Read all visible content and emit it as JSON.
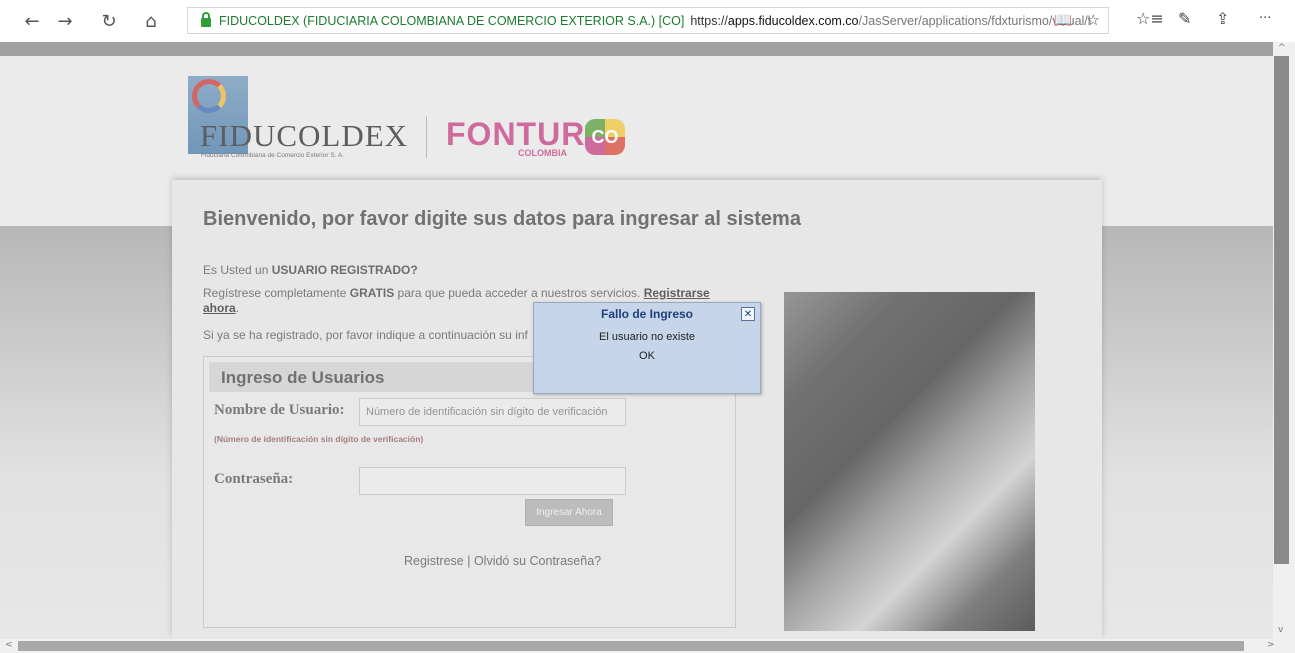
{
  "browser": {
    "address": {
      "site_identity": "FIDUCOLDEX (FIDUCIARIA COLOMBIANA DE COMERCIO EXTERIOR S.A.) [CO]",
      "url_scheme": "https://",
      "url_host": "apps.fiducoldex.com.co",
      "url_path": "/JasServer/applications/fdxturismo/visual/l"
    },
    "icons": {
      "back": "←",
      "forward": "→",
      "refresh": "↻",
      "home": "⌂",
      "reading_view": "📖",
      "favorite": "☆",
      "favorites_hub": "☆≡",
      "notes": "✎",
      "share": "⇪",
      "more": "···"
    }
  },
  "logos": {
    "fiducoldex_name": "FIDUCOLDEX",
    "fiducoldex_sub": "Fiduciaria Colombiana de Comercio Exterior S. A.",
    "fontur": "FONTUR",
    "fontur_sub": "COLOMBIA",
    "co_badge": "CO"
  },
  "main": {
    "welcome": "Bienvenido, por favor digite sus datos para ingresar al sistema",
    "registered_prefix": "Es Usted un ",
    "registered_bold": "USUARIO REGISTRADO?",
    "register_prefix": "Regístrese completamente ",
    "register_bold": "GRATIS",
    "register_middle": " para que pueda acceder a nuestros servicios. ",
    "register_link_1": "Registrarse",
    "register_link_2": "ahora",
    "register_dot": ".",
    "already_registered": "Si ya se ha registrado, por favor indique a continuación su inf"
  },
  "login": {
    "title": "Ingreso de Usuarios",
    "username_label": "Nombre de Usuario:",
    "username_placeholder": "Número de identificación sin dígito de verificación",
    "username_hint": "(Número de identificación sin dígito de verificación)",
    "password_label": "Contraseña:",
    "password_value": "",
    "submit_label": "Ingresar Ahora",
    "register_link": "Registrese",
    "separator": " | ",
    "forgot_link": "Olvidó su Contraseña?"
  },
  "dialog": {
    "title": "Fallo de Ingreso",
    "message": "El usuario no existe",
    "ok_label": "OK",
    "close_icon": "✕"
  },
  "colors": {
    "dialog_bg": "#c6d5e9",
    "dialog_title": "#1f3f7a",
    "site_identity": "#1d7a2e",
    "fontur_brand": "#c04080"
  }
}
